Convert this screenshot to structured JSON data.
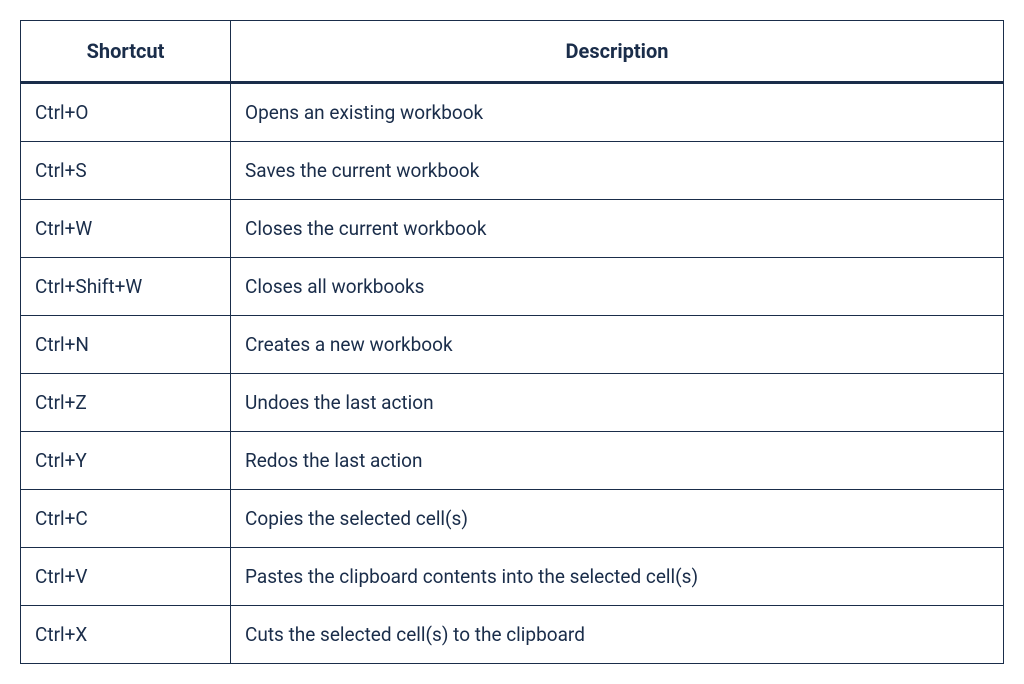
{
  "table": {
    "headers": {
      "shortcut": "Shortcut",
      "description": "Description"
    },
    "rows": [
      {
        "shortcut": "Ctrl+O",
        "description": "Opens an existing workbook"
      },
      {
        "shortcut": "Ctrl+S",
        "description": "Saves the current workbook"
      },
      {
        "shortcut": "Ctrl+W",
        "description": "Closes the current workbook"
      },
      {
        "shortcut": "Ctrl+Shift+W",
        "description": "Closes all workbooks"
      },
      {
        "shortcut": "Ctrl+N",
        "description": "Creates a new workbook"
      },
      {
        "shortcut": "Ctrl+Z",
        "description": "Undoes the last action"
      },
      {
        "shortcut": "Ctrl+Y",
        "description": "Redos the last action"
      },
      {
        "shortcut": "Ctrl+C",
        "description": "Copies the selected cell(s)"
      },
      {
        "shortcut": "Ctrl+V",
        "description": "Pastes the clipboard contents into the selected cell(s)"
      },
      {
        "shortcut": "Ctrl+X",
        "description": "Cuts the selected cell(s) to the clipboard"
      }
    ]
  }
}
